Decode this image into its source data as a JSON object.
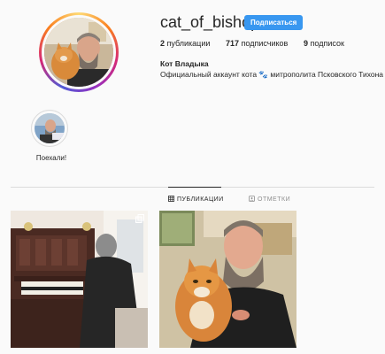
{
  "profile": {
    "username": "cat_of_bishop",
    "follow_label": "Подписаться",
    "posts_count": "2",
    "posts_label": "публикации",
    "followers_count": "717",
    "followers_label": "подписчиков",
    "following_count": "9",
    "following_label": "подписок",
    "full_name": "Кот Владыка",
    "bio": "Официальный аккаунт кота 🐾 митрополита Псковского Тихона"
  },
  "highlights": [
    {
      "label": "Поехали!"
    }
  ],
  "tabs": [
    {
      "label": "ПУБЛИКАЦИИ",
      "icon": "grid-icon",
      "active": true
    },
    {
      "label": "ОТМЕТКИ",
      "icon": "tag-icon",
      "active": false
    }
  ],
  "posts": [
    {
      "description": "person-playing-organ",
      "overlay_icon": "multiple-photos-icon"
    },
    {
      "description": "bishop-holding-cat"
    }
  ],
  "colors": {
    "accent": "#3897f0",
    "text": "#262626",
    "muted": "#8e8e8e",
    "border": "#dbdbdb",
    "background": "#fafafa"
  }
}
